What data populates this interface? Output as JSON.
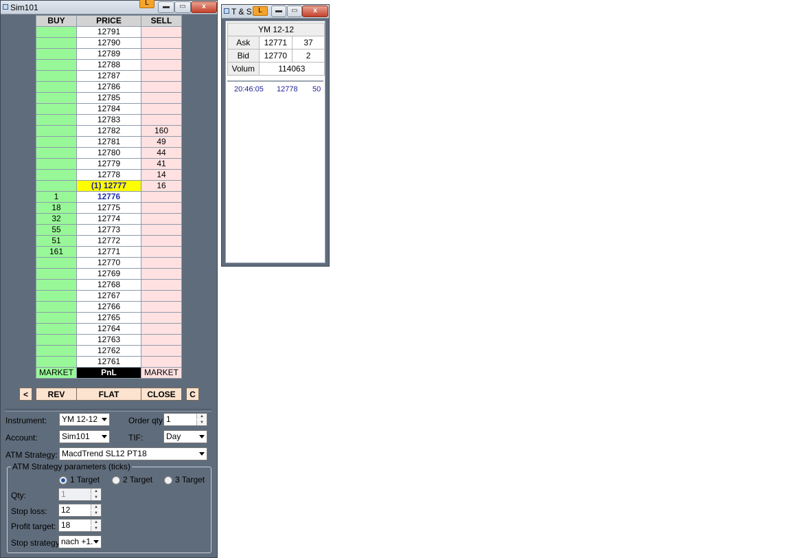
{
  "dom_window": {
    "title": "Sim101",
    "lock_label": "L",
    "controls": {
      "minimize": "—",
      "maximize": "□",
      "close": "x"
    },
    "headers": {
      "buy": "BUY",
      "price": "PRICE",
      "sell": "SELL"
    },
    "rows": [
      {
        "buy": "",
        "price": "12791",
        "sell": ""
      },
      {
        "buy": "",
        "price": "12790",
        "sell": ""
      },
      {
        "buy": "",
        "price": "12789",
        "sell": ""
      },
      {
        "buy": "",
        "price": "12788",
        "sell": ""
      },
      {
        "buy": "",
        "price": "12787",
        "sell": ""
      },
      {
        "buy": "",
        "price": "12786",
        "sell": ""
      },
      {
        "buy": "",
        "price": "12785",
        "sell": ""
      },
      {
        "buy": "",
        "price": "12784",
        "sell": ""
      },
      {
        "buy": "",
        "price": "12783",
        "sell": ""
      },
      {
        "buy": "",
        "price": "12782",
        "sell": "160"
      },
      {
        "buy": "",
        "price": "12781",
        "sell": "49"
      },
      {
        "buy": "",
        "price": "12780",
        "sell": "44"
      },
      {
        "buy": "",
        "price": "12779",
        "sell": "41"
      },
      {
        "buy": "",
        "price": "12778",
        "sell": "14"
      },
      {
        "buy": "",
        "price": "(1) 12777",
        "sell": "16",
        "highlight": "last"
      },
      {
        "buy": "1",
        "price": "12776",
        "sell": "",
        "highlight": "bid"
      },
      {
        "buy": "18",
        "price": "12775",
        "sell": ""
      },
      {
        "buy": "32",
        "price": "12774",
        "sell": ""
      },
      {
        "buy": "55",
        "price": "12773",
        "sell": ""
      },
      {
        "buy": "51",
        "price": "12772",
        "sell": ""
      },
      {
        "buy": "161",
        "price": "12771",
        "sell": ""
      },
      {
        "buy": "",
        "price": "12770",
        "sell": ""
      },
      {
        "buy": "",
        "price": "12769",
        "sell": ""
      },
      {
        "buy": "",
        "price": "12768",
        "sell": ""
      },
      {
        "buy": "",
        "price": "12767",
        "sell": ""
      },
      {
        "buy": "",
        "price": "12766",
        "sell": ""
      },
      {
        "buy": "",
        "price": "12765",
        "sell": ""
      },
      {
        "buy": "",
        "price": "12764",
        "sell": ""
      },
      {
        "buy": "",
        "price": "12763",
        "sell": ""
      },
      {
        "buy": "",
        "price": "12762",
        "sell": ""
      },
      {
        "buy": "",
        "price": "12761",
        "sell": ""
      }
    ],
    "footer": {
      "buy_market": "MARKET",
      "pnl": "PnL",
      "sell_market": "MARKET"
    },
    "actions": {
      "left": "<",
      "rev": "REV",
      "flat": "FLAT",
      "close": "CLOSE",
      "c": "C"
    },
    "form": {
      "instrument_label": "Instrument:",
      "instrument_value": "YM 12-12",
      "order_qty_label": "Order qty:",
      "order_qty_value": "1",
      "account_label": "Account:",
      "account_value": "Sim101",
      "tif_label": "TIF:",
      "tif_value": "Day",
      "atm_label": "ATM Strategy:",
      "atm_value": "MacdTrend SL12 PT18",
      "params_title": "ATM Strategy parameters (ticks)",
      "targets": [
        "1 Target",
        "2 Target",
        "3 Target"
      ],
      "selected_target": 0,
      "qty_label": "Qty:",
      "qty_value": "1",
      "stop_loss_label": "Stop loss:",
      "stop_loss_value": "12",
      "profit_target_label": "Profit target:",
      "profit_target_value": "18",
      "stop_strategy_label": "Stop strategy:",
      "stop_strategy_value": "nach +1."
    },
    "colors": {
      "buy": "#98f898",
      "sell": "#ffe1e1",
      "last": "#ffff00",
      "pnl_bg": "#000000",
      "window_bg": "#5f6c7b"
    }
  },
  "ts_window": {
    "title": "T & S",
    "lock_label": "L",
    "instrument": "YM 12-12",
    "ask_label": "Ask",
    "ask_price": "12771",
    "ask_size": "37",
    "bid_label": "Bid",
    "bid_price": "12770",
    "bid_size": "2",
    "volume_label": "Volum",
    "volume_value": "114063",
    "trades": [
      {
        "time": "20:46:05",
        "price": "12778",
        "size": "50"
      }
    ]
  }
}
